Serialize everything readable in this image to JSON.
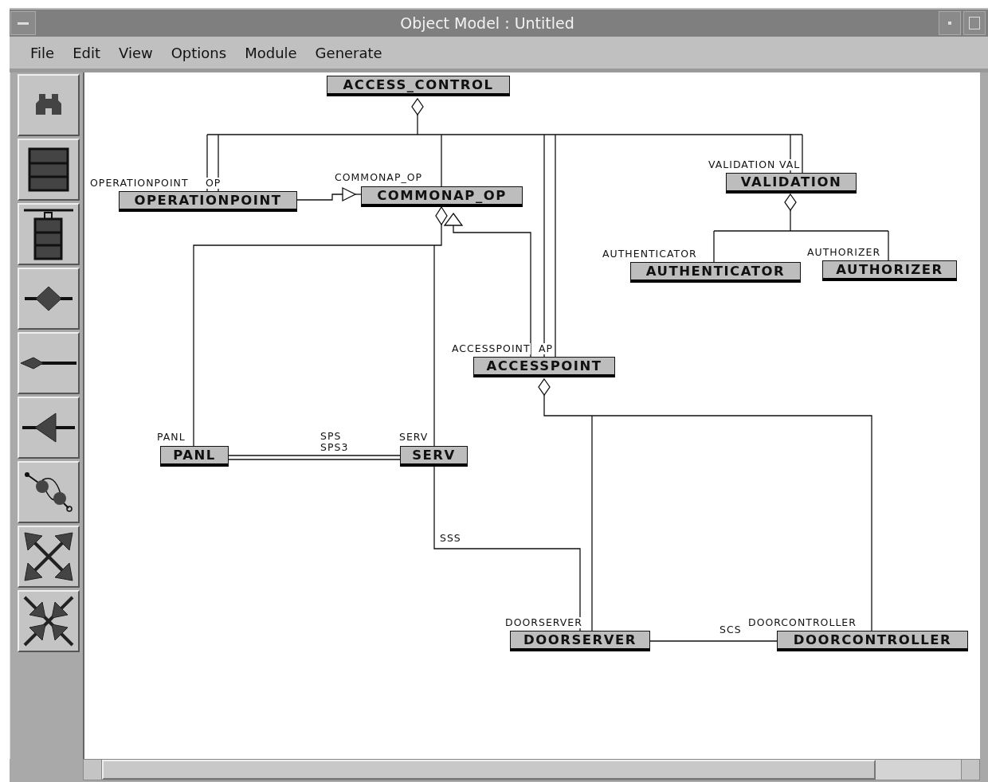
{
  "window": {
    "title": "Object Model : Untitled"
  },
  "menu": [
    "File",
    "Edit",
    "View",
    "Options",
    "Module",
    "Generate"
  ],
  "diagram": {
    "classes": [
      {
        "name": "ACCESS_CONTROL"
      },
      {
        "name": "OPERATIONPOINT"
      },
      {
        "name": "COMMONAP_OP"
      },
      {
        "name": "VALIDATION"
      },
      {
        "name": "AUTHENTICATOR"
      },
      {
        "name": "AUTHORIZER"
      },
      {
        "name": "ACCESSPOINT"
      },
      {
        "name": "PANL"
      },
      {
        "name": "SERV"
      },
      {
        "name": "DOORSERVER"
      },
      {
        "name": "DOORCONTROLLER"
      }
    ],
    "role_labels": [
      "OPERATIONPOINT",
      "OP",
      "COMMONAP_OP",
      "VALIDATION",
      "VAL",
      "AUTHENTICATOR",
      "AUTHORIZER",
      "ACCESSPOINT",
      "AP",
      "PANL",
      "SPS",
      "SPS3",
      "SERV",
      "SSS",
      "DOORSERVER",
      "SCS",
      "DOORCONTROLLER"
    ]
  }
}
